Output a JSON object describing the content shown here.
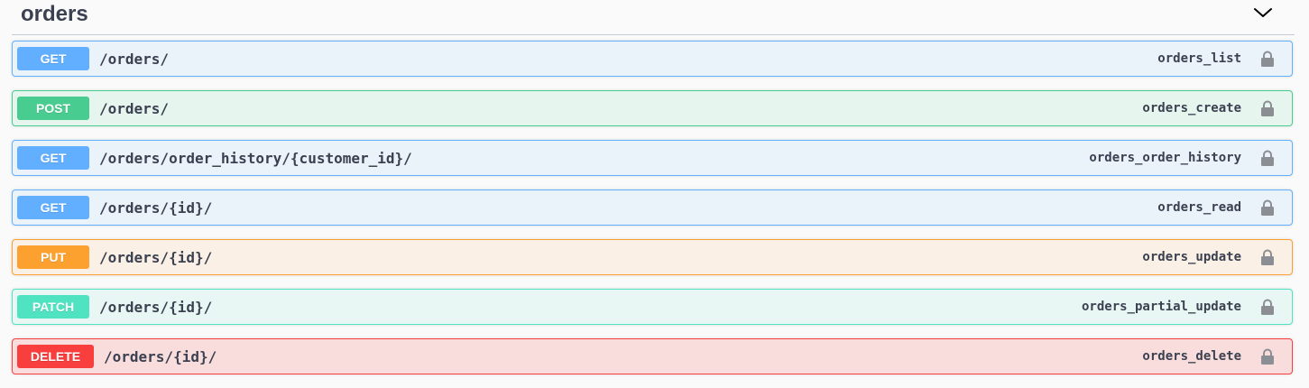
{
  "section": {
    "title": "orders",
    "toggle_icon": "chevron-down-icon"
  },
  "colors": {
    "get": "#61affe",
    "post": "#49cc90",
    "put": "#fca130",
    "patch": "#50e3c2",
    "delete": "#f93e3e",
    "text": "#3b4151"
  },
  "operations": [
    {
      "method": "GET",
      "path": "/orders/",
      "operation_id": "orders_list",
      "lock_icon": "lock-icon"
    },
    {
      "method": "POST",
      "path": "/orders/",
      "operation_id": "orders_create",
      "lock_icon": "lock-icon"
    },
    {
      "method": "GET",
      "path": "/orders/order_history/{customer_id}/",
      "operation_id": "orders_order_history",
      "lock_icon": "lock-icon"
    },
    {
      "method": "GET",
      "path": "/orders/{id}/",
      "operation_id": "orders_read",
      "lock_icon": "lock-icon"
    },
    {
      "method": "PUT",
      "path": "/orders/{id}/",
      "operation_id": "orders_update",
      "lock_icon": "lock-icon"
    },
    {
      "method": "PATCH",
      "path": "/orders/{id}/",
      "operation_id": "orders_partial_update",
      "lock_icon": "lock-icon"
    },
    {
      "method": "DELETE",
      "path": "/orders/{id}/",
      "operation_id": "orders_delete",
      "lock_icon": "lock-icon"
    }
  ]
}
